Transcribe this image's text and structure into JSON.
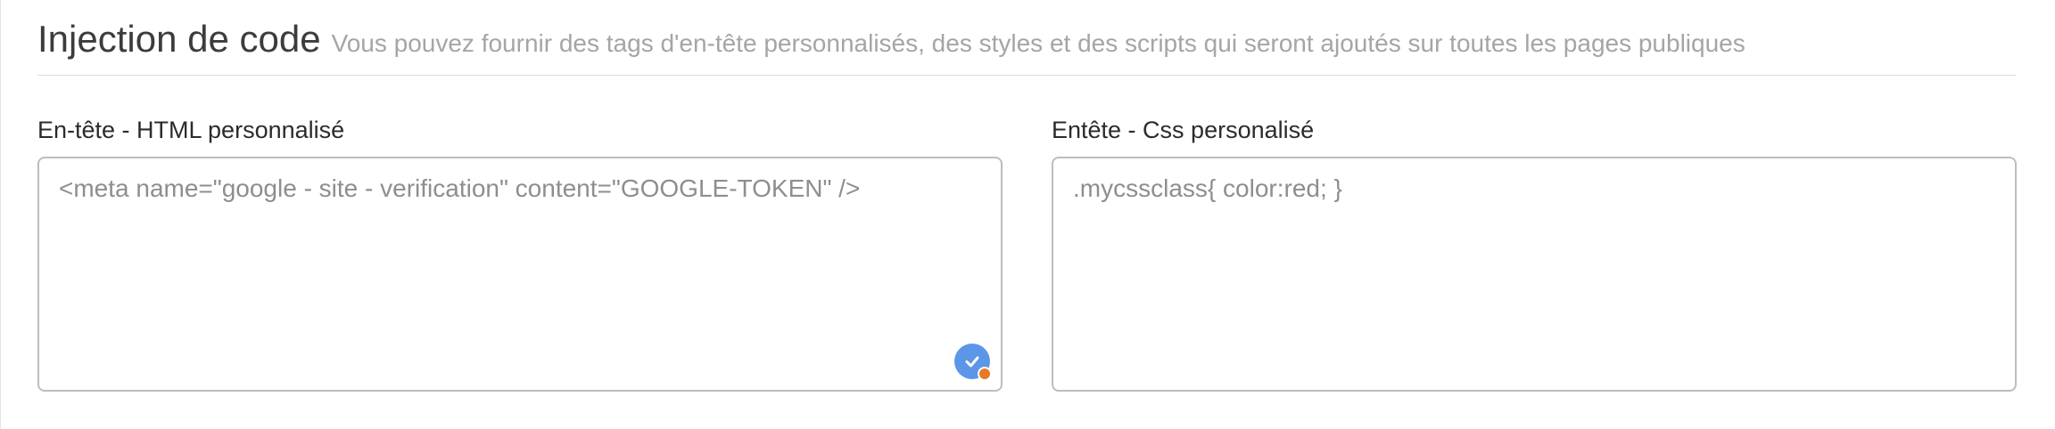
{
  "section": {
    "title": "Injection de code",
    "subtitle": "Vous pouvez fournir des tags d'en-tête personnalisés, des styles et des scripts qui seront ajoutés sur toutes les pages publiques"
  },
  "fields": {
    "html_header": {
      "label": "En-tête - HTML personnalisé",
      "value": "",
      "placeholder": "<meta name=\"google - site - verification\" content=\"GOOGLE-TOKEN\" />"
    },
    "css_header": {
      "label": "Entête - Css personalisé",
      "value": "",
      "placeholder": ".mycssclass{ color:red; }"
    }
  },
  "icons": {
    "grammar_check": "check-circle-icon"
  },
  "colors": {
    "badge_blue": "#5b96e8",
    "badge_dot_orange": "#e77a2a",
    "border": "#bdbdbd",
    "subtitle": "#a5a5a5"
  }
}
